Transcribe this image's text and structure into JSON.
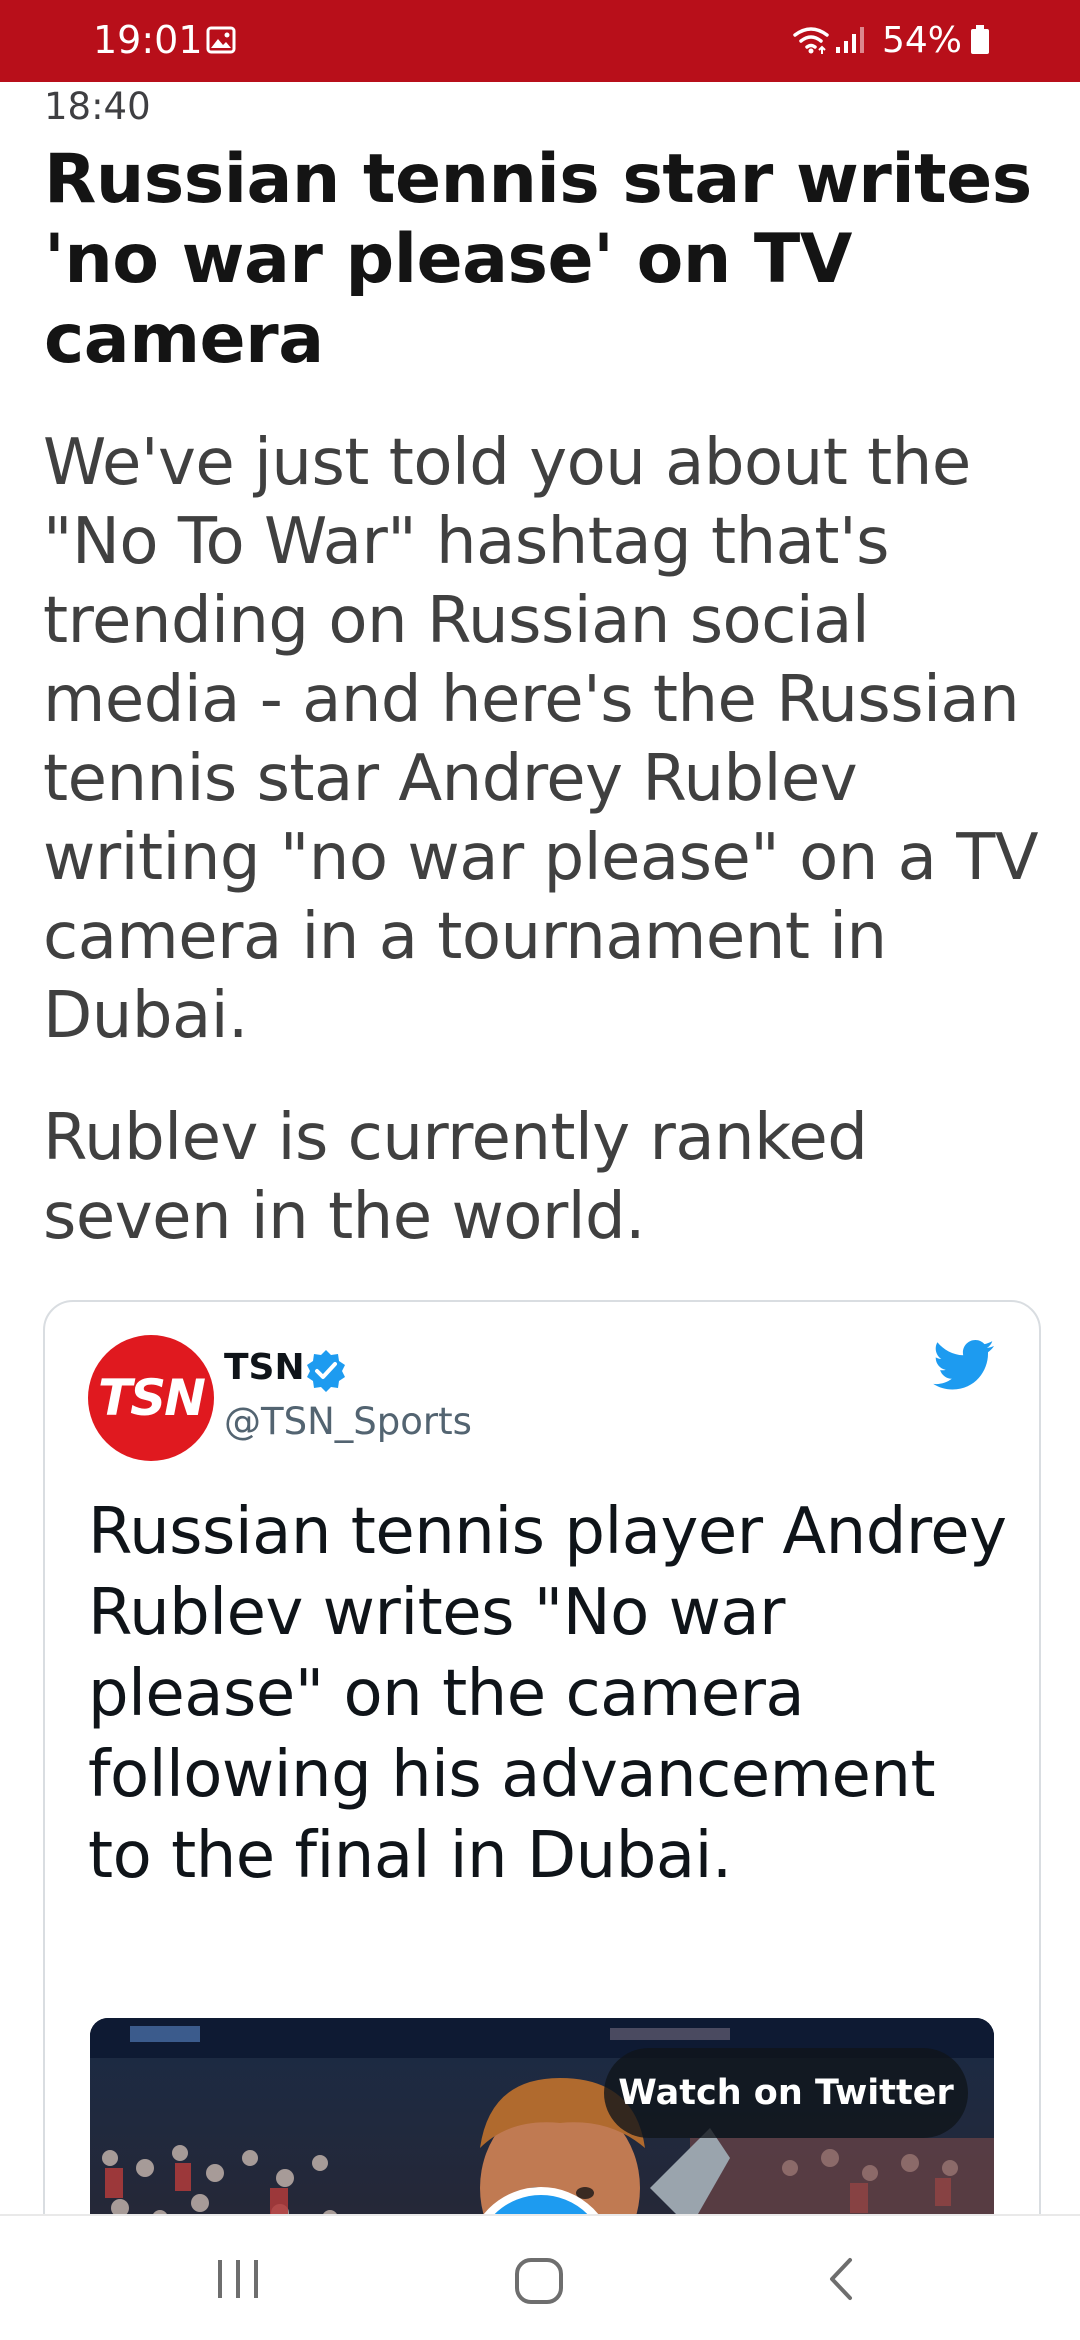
{
  "status_bar": {
    "time": "19:01",
    "battery": "54%",
    "background_color": "#b80f1a",
    "icons": [
      "gallery-icon",
      "wifi-icon",
      "signal-icon",
      "battery-icon"
    ]
  },
  "article": {
    "post_time": "18:40",
    "headline": "Russian tennis star writes 'no war please' on TV camera",
    "paragraphs": [
      "We've just told you about the \"No To War\" hashtag that's trending on Russian social media - and here's the Russian tennis star Andrey Rublev writing \"no war please\" on a TV camera in a tournament in Dubai.",
      "Rublev is currently ranked seven in the world."
    ]
  },
  "tweet": {
    "avatar_text": "TSN",
    "display_name": "TSN",
    "handle": "@TSN_Sports",
    "verified": true,
    "text": "Russian tennis player Andrey Rublev writes \"No war please\" on the camera following his advancement to the final in Dubai.",
    "video": {
      "watch_label": "Watch on Twitter"
    },
    "accent_color": "#1d9bf0"
  },
  "nav_bar": {
    "buttons": [
      "recents-icon",
      "home-icon",
      "back-icon"
    ]
  }
}
